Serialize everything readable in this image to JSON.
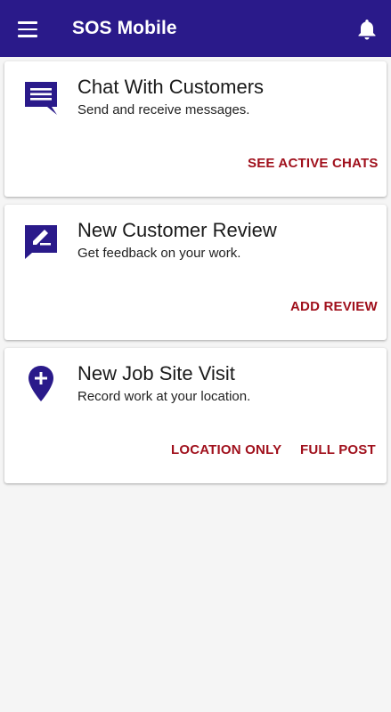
{
  "app_bar": {
    "title": "SOS Mobile",
    "menu_icon": "hamburger-menu-icon",
    "notification_icon": "bell-icon",
    "background_color": "#2a1a8a"
  },
  "cards": [
    {
      "icon": "chat-message-icon",
      "title": "Chat With Customers",
      "subtitle": "Send and receive messages.",
      "actions": [
        "SEE ACTIVE CHATS"
      ]
    },
    {
      "icon": "review-edit-icon",
      "title": "New Customer Review",
      "subtitle": "Get feedback on your work.",
      "actions": [
        "ADD REVIEW"
      ]
    },
    {
      "icon": "location-add-icon",
      "title": "New Job Site Visit",
      "subtitle": "Record work at your location.",
      "actions": [
        "LOCATION ONLY",
        "FULL POST"
      ]
    }
  ],
  "colors": {
    "accent": "#a0101c",
    "icon": "#2a1a8a"
  }
}
